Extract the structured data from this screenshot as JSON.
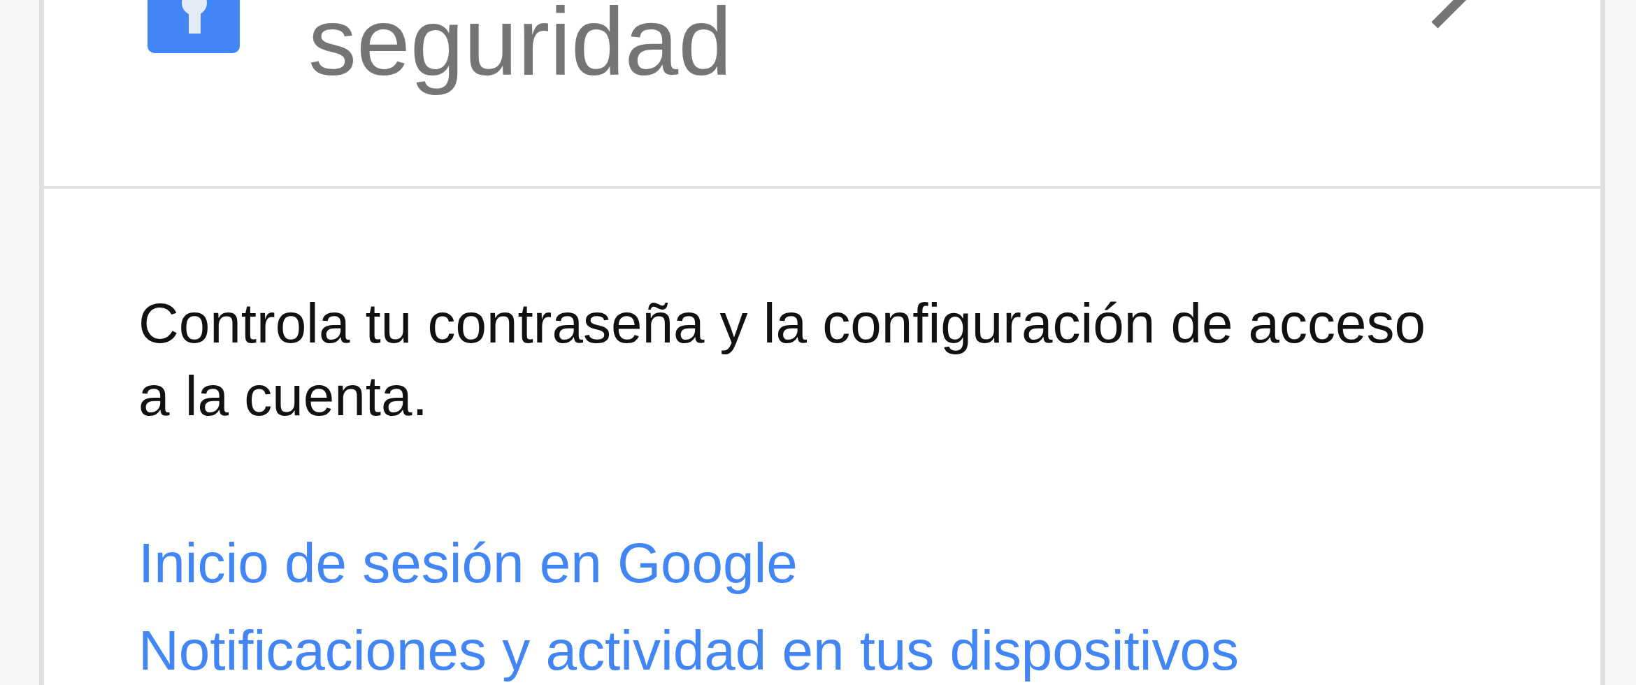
{
  "card": {
    "title": "seguridad",
    "description": "Controla tu contraseña y la configuración de acceso a la cuenta.",
    "links": [
      "Inicio de sesión en Google",
      "Notificaciones y actividad en tus dispositivos"
    ]
  }
}
